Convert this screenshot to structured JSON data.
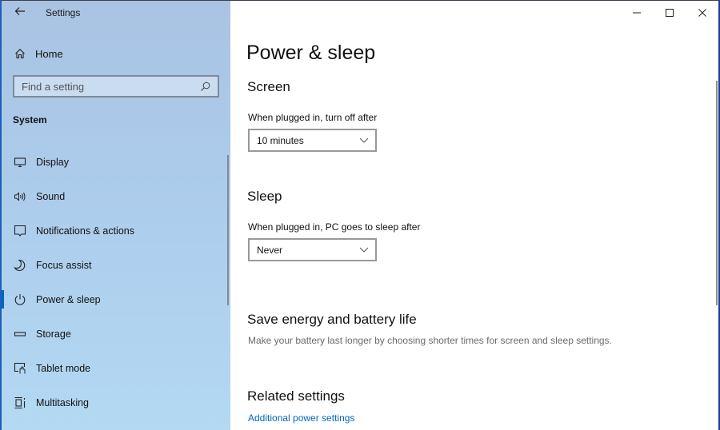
{
  "window": {
    "title": "Settings",
    "controls": {
      "minimize": "minimize-icon",
      "maximize": "maximize-icon",
      "close": "close-icon"
    }
  },
  "sidebar": {
    "back_icon": "arrow-left-icon",
    "home": {
      "label": "Home",
      "icon": "home-icon"
    },
    "search": {
      "placeholder": "Find a setting",
      "value": "",
      "icon": "search-icon"
    },
    "section": "System",
    "items": [
      {
        "label": "Display",
        "icon": "monitor-icon",
        "selected": false
      },
      {
        "label": "Sound",
        "icon": "speaker-icon",
        "selected": false
      },
      {
        "label": "Notifications & actions",
        "icon": "notification-icon",
        "selected": false
      },
      {
        "label": "Focus assist",
        "icon": "moon-icon",
        "selected": false
      },
      {
        "label": "Power & sleep",
        "icon": "power-icon",
        "selected": true
      },
      {
        "label": "Storage",
        "icon": "storage-icon",
        "selected": false
      },
      {
        "label": "Tablet mode",
        "icon": "tablet-mode-icon",
        "selected": false
      },
      {
        "label": "Multitasking",
        "icon": "multitasking-icon",
        "selected": false
      }
    ]
  },
  "main": {
    "title": "Power & sleep",
    "screen": {
      "heading": "Screen",
      "label": "When plugged in, turn off after",
      "value": "10 minutes"
    },
    "sleep": {
      "heading": "Sleep",
      "label": "When plugged in, PC goes to sleep after",
      "value": "Never"
    },
    "save_energy": {
      "heading": "Save energy and battery life",
      "description": "Make your battery last longer by choosing shorter times for screen and sleep settings."
    },
    "related": {
      "heading": "Related settings",
      "link": "Additional power settings"
    }
  },
  "colors": {
    "accent": "#0067c0",
    "sidebar_top": "#a9c3e3",
    "sidebar_bottom": "#b3d9f3"
  }
}
